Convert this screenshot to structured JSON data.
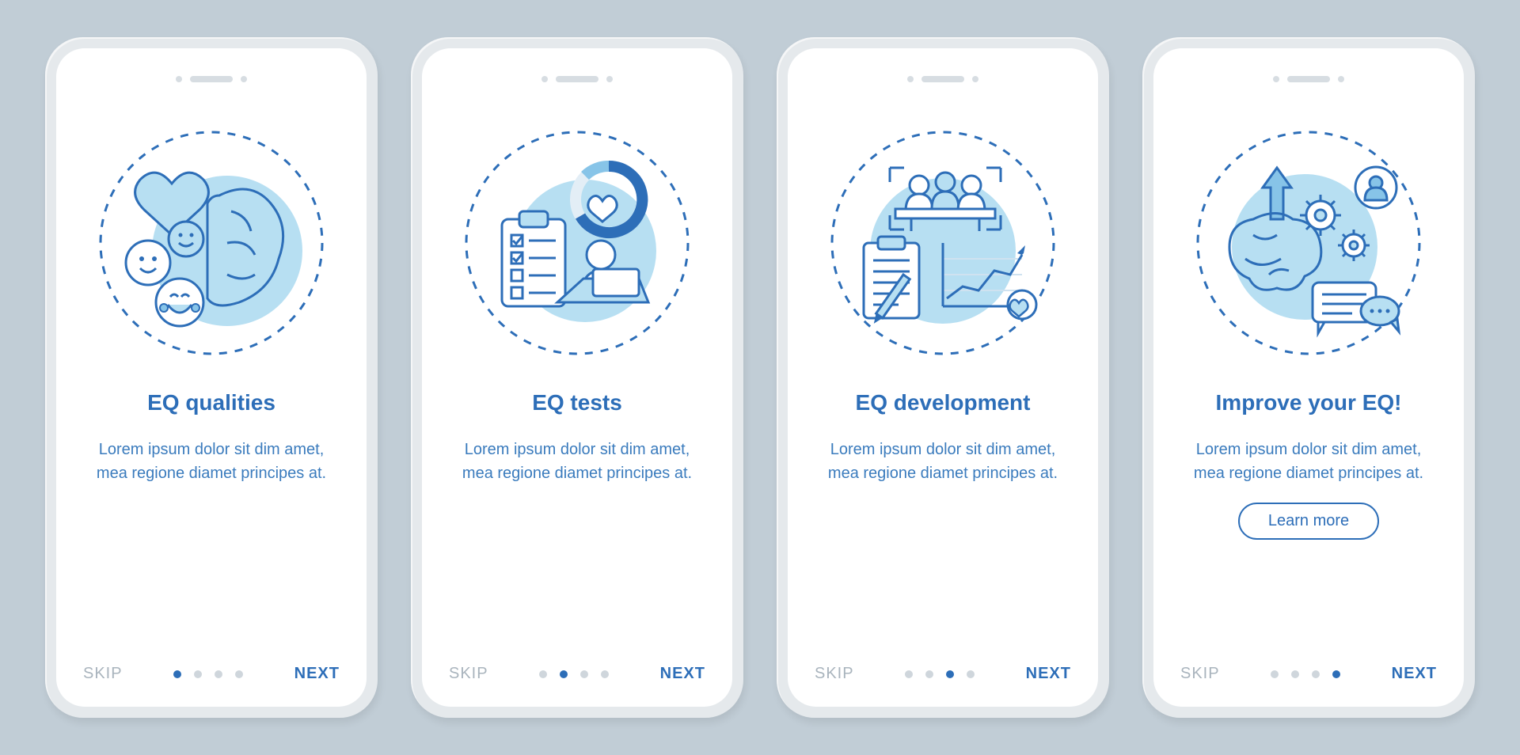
{
  "colors": {
    "primary": "#2d6eb8",
    "accent": "#87c4e8",
    "muted": "#a9b4bd",
    "bg": "#c1cdd6"
  },
  "screens": [
    {
      "title": "EQ qualities",
      "body": "Lorem ipsum dolor sit dim amet, mea regione diamet principes at.",
      "skip": "SKIP",
      "next": "NEXT",
      "active_index": 0,
      "cta": null,
      "icon": "eq-qualities-icon"
    },
    {
      "title": "EQ tests",
      "body": "Lorem ipsum dolor sit dim amet, mea regione diamet principes at.",
      "skip": "SKIP",
      "next": "NEXT",
      "active_index": 1,
      "cta": null,
      "icon": "eq-tests-icon"
    },
    {
      "title": "EQ development",
      "body": "Lorem ipsum dolor sit dim amet, mea regione diamet principes at.",
      "skip": "SKIP",
      "next": "NEXT",
      "active_index": 2,
      "cta": null,
      "icon": "eq-development-icon"
    },
    {
      "title": "Improve your EQ!",
      "body": "Lorem ipsum dolor sit dim amet, mea regione diamet principes at.",
      "skip": "SKIP",
      "next": "NEXT",
      "active_index": 3,
      "cta": "Learn more",
      "icon": "improve-eq-icon"
    }
  ],
  "total_pages": 4
}
